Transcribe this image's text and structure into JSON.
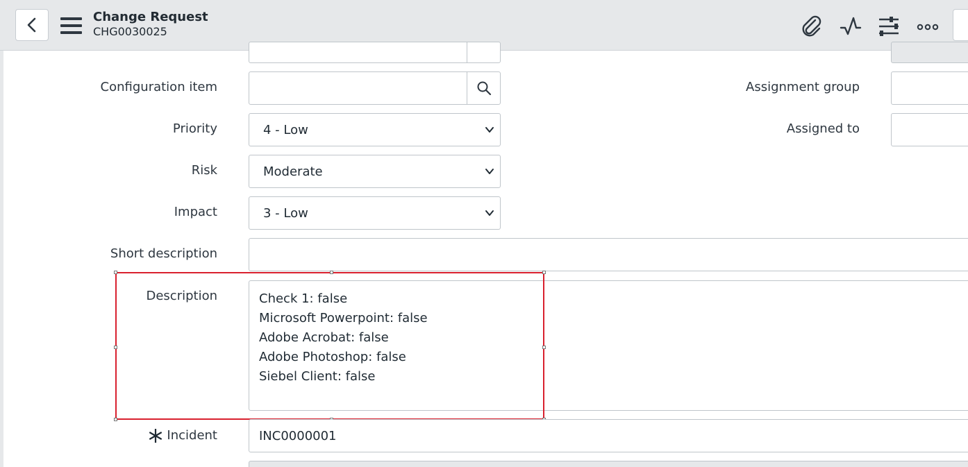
{
  "header": {
    "back_icon": "chevron-left-icon",
    "menu_icon": "hamburger-icon",
    "title": "Change Request",
    "record_number": "CHG0030025",
    "actions": [
      {
        "icon": "paperclip-icon"
      },
      {
        "icon": "activity-icon"
      },
      {
        "icon": "sliders-icon"
      },
      {
        "icon": "more-icon"
      }
    ]
  },
  "form": {
    "configuration_item": {
      "label": "Configuration item",
      "value": ""
    },
    "priority": {
      "label": "Priority",
      "value": "4 - Low"
    },
    "risk": {
      "label": "Risk",
      "value": "Moderate"
    },
    "impact": {
      "label": "Impact",
      "value": "3 - Low"
    },
    "short_description": {
      "label": "Short description",
      "value": ""
    },
    "description": {
      "label": "Description",
      "lines": [
        "Check 1: false",
        "Microsoft Powerpoint: false",
        "Adobe Acrobat: false",
        "Adobe Photoshop: false",
        "Siebel Client: false"
      ]
    },
    "incident": {
      "label": "Incident",
      "value": "INC0000001",
      "required": true
    },
    "assignment_group": {
      "label": "Assignment group",
      "value": ""
    },
    "assigned_to": {
      "label": "Assigned to",
      "value": ""
    }
  },
  "colors": {
    "header_bg": "#e6e8ea",
    "highlight": "#d9202e",
    "field_border": "#bfc5ca"
  }
}
